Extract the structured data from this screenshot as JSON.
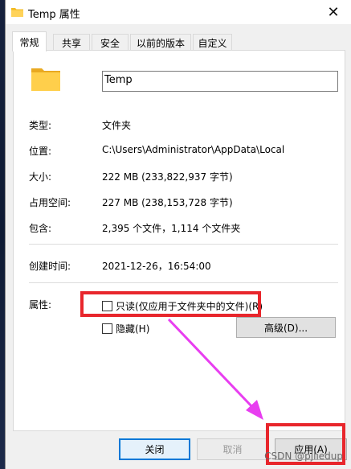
{
  "window": {
    "title": "Temp 属性",
    "close_glyph": "✕"
  },
  "tabs": [
    {
      "label": "常规",
      "active": true
    },
    {
      "label": "共享",
      "active": false
    },
    {
      "label": "安全",
      "active": false
    },
    {
      "label": "以前的版本",
      "active": false
    },
    {
      "label": "自定义",
      "active": false
    }
  ],
  "general": {
    "folder_name": "Temp",
    "type_label": "类型:",
    "type_value": "文件夹",
    "location_label": "位置:",
    "location_value": "C:\\Users\\Administrator\\AppData\\Local",
    "size_label": "大小:",
    "size_value": "222 MB (233,822,937 字节)",
    "disk_size_label": "占用空间:",
    "disk_size_value": "227 MB (238,153,728 字节)",
    "contains_label": "包含:",
    "contains_value": "2,395 个文件，1,114 个文件夹",
    "created_label": "创建时间:",
    "created_value": "2021-12-26，16:54:00",
    "attributes_label": "属性:",
    "readonly_label": "只读(仅应用于文件夹中的文件)(R)",
    "readonly_checked": false,
    "hidden_label": "隐藏(H)",
    "hidden_checked": false,
    "advanced_button": "高级(D)..."
  },
  "footer": {
    "close_button": "关闭",
    "cancel_button": "取消",
    "apply_button": "应用(A)"
  },
  "annotations": {
    "highlight_color": "#e8262c",
    "arrow_color": "#e83ef0",
    "watermark": "CSDN @pjliedup"
  },
  "colors": {
    "folder": "#f6c94a",
    "accent": "#0078d7"
  }
}
